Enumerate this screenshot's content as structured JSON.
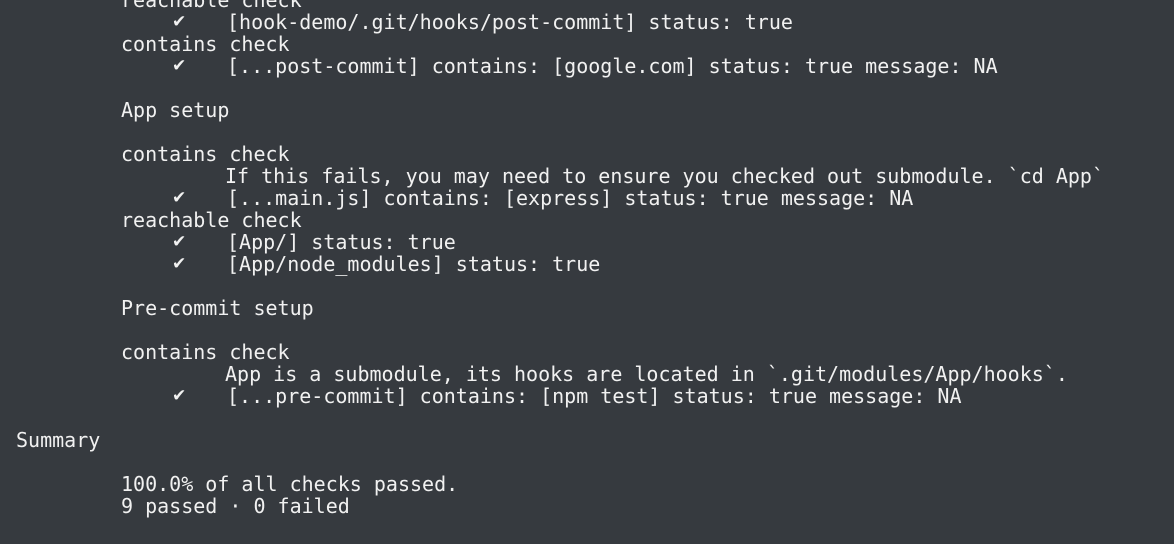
{
  "lines": {
    "l00": "reachable check",
    "l01": "[hook-demo/.git/hooks/post-commit] status: true",
    "l02": "contains check",
    "l03": "[...post-commit] contains: [google.com] status: true message: NA",
    "l04": "App setup",
    "l05": "contains check",
    "l06": "If this fails, you may need to ensure you checked out submodule. `cd App`",
    "l07": "[...main.js] contains: [express] status: true message: NA",
    "l08": "reachable check",
    "l09": "[App/] status: true",
    "l10": "[App/node_modules] status: true",
    "l11": "Pre-commit setup",
    "l12": "contains check",
    "l13": "App is a submodule, its hooks are located in `.git/modules/App/hooks`.",
    "l14": "[...pre-commit] contains: [npm test] status: true message: NA",
    "l15": "Summary",
    "l16": "100.0% of all checks passed.",
    "l17": "9 passed · 0 failed"
  },
  "checkmark": "✔",
  "icons": {
    "check": "check-mark-icon"
  },
  "colors": {
    "background": "#363a3f",
    "text": "#f1f1f1"
  }
}
